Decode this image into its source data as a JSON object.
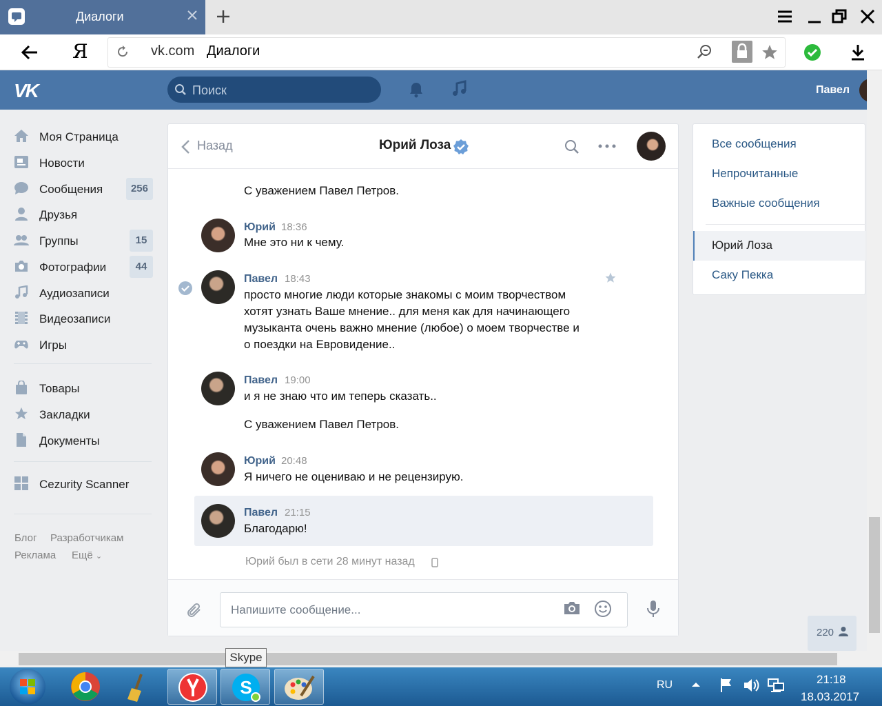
{
  "browser": {
    "tab_title": "Диалоги",
    "url_domain": "vk.com",
    "url_title": "Диалоги",
    "brand_letter": "Я"
  },
  "header": {
    "logo": "VK",
    "search_placeholder": "Поиск",
    "username": "Павел"
  },
  "nav": {
    "items": [
      {
        "label": "Моя Страница",
        "icon": "home-icon"
      },
      {
        "label": "Новости",
        "icon": "news-icon"
      },
      {
        "label": "Сообщения",
        "icon": "messages-icon",
        "badge": "256"
      },
      {
        "label": "Друзья",
        "icon": "friends-icon"
      },
      {
        "label": "Группы",
        "icon": "groups-icon",
        "badge": "15"
      },
      {
        "label": "Фотографии",
        "icon": "camera-icon",
        "badge": "44"
      },
      {
        "label": "Аудиозаписи",
        "icon": "music-note-icon"
      },
      {
        "label": "Видеозаписи",
        "icon": "film-icon"
      },
      {
        "label": "Игры",
        "icon": "gamepad-icon"
      },
      {
        "label": "Товары",
        "icon": "shopping-bag-icon"
      },
      {
        "label": "Закладки",
        "icon": "star-icon"
      },
      {
        "label": "Документы",
        "icon": "document-icon"
      },
      {
        "label": "Cezurity Scanner",
        "icon": "app-grid-icon"
      }
    ],
    "footer": [
      "Блог",
      "Разработчикам",
      "Реклама",
      "Ещё"
    ]
  },
  "dialog": {
    "back_label": "Назад",
    "title": "Юрий Лоза",
    "messages": [
      {
        "text": "С уважением Павел Петров."
      },
      {
        "author": "Юрий",
        "time": "18:36",
        "text": "Мне это ни к чему."
      },
      {
        "author": "Павел",
        "time": "18:43",
        "lines": [
          "просто многие люди которые знакомы с моим творчеством",
          "хотят узнать Ваше мнение.. для меня как для начинающего",
          "музыканта очень важно мнение (любое) о моем творчестве и",
          "о поездки на Евровидение.."
        ]
      },
      {
        "author": "Павел",
        "time": "19:00",
        "text": "и я не знаю что им теперь сказать.."
      },
      {
        "text": "С уважением Павел Петров."
      },
      {
        "author": "Юрий",
        "time": "20:48",
        "text": "Я ничего не оцениваю и не рецензирую."
      },
      {
        "author": "Павел",
        "time": "21:15",
        "text": "Благодарю!"
      }
    ],
    "last_seen": "Юрий был в сети 28 минут назад",
    "input_placeholder": "Напишите сообщение..."
  },
  "right_panel": {
    "filters": [
      "Все сообщения",
      "Непрочитанные",
      "Важные сообщения"
    ],
    "conversations": [
      "Юрий Лоза",
      "Саку Пекка"
    ]
  },
  "online_count": "220",
  "taskbar": {
    "tooltip": "Skype",
    "lang": "RU",
    "time": "21:18",
    "date": "18.03.2017"
  },
  "colors": {
    "vk_blue": "#4a76a8",
    "link": "#2a5885",
    "author": "#42648b",
    "background": "#edeef0"
  }
}
